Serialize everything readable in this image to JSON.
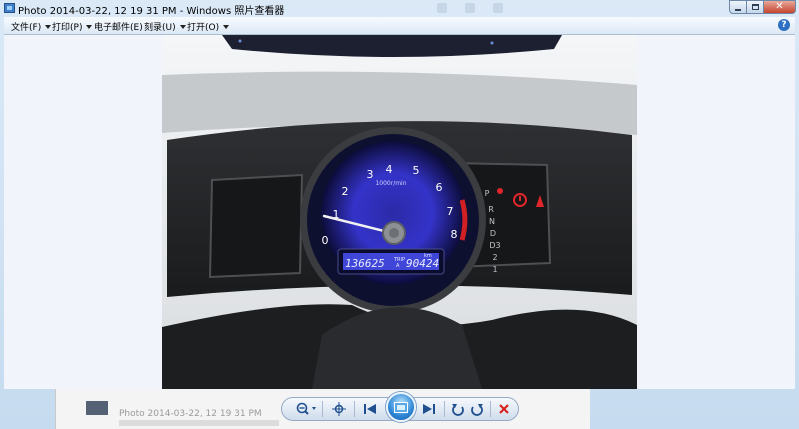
{
  "window": {
    "title": "Photo 2014-03-22, 12 19 31 PM - Windows 照片查看器",
    "close_glyph": "✕"
  },
  "menubar": {
    "items": [
      {
        "label": "文件(F)"
      },
      {
        "label": "打印(P)"
      },
      {
        "label": "电子邮件(E)"
      },
      {
        "label": "刻录(U)"
      },
      {
        "label": "打开(O)"
      }
    ],
    "help_glyph": "?"
  },
  "photo": {
    "icon": "photo-icon",
    "gauge_numbers": [
      "0",
      "1",
      "2",
      "3",
      "4",
      "5",
      "6",
      "7",
      "8"
    ],
    "gauge_unit": "1000r/min",
    "odometer": "136625",
    "trip": "90424",
    "trip_label": "TRIP",
    "trip_sub": "A",
    "trip_unit": "km",
    "gears": [
      "P",
      "R",
      "N",
      "D",
      "D3",
      "2",
      "1"
    ]
  },
  "behind_window": {
    "text": "Photo 2014-03-22, 12 19 31 PM"
  },
  "toolbar": {
    "icons": [
      "zoom-icon",
      "fit-icon",
      "previous-icon",
      "slideshow-icon",
      "next-icon",
      "rotate-left-icon",
      "rotate-right-icon",
      "delete-icon"
    ]
  },
  "colors": {
    "accent": "#2c86d6",
    "gauge_glow": "#3b3ad8",
    "warning": "#e0262b"
  }
}
